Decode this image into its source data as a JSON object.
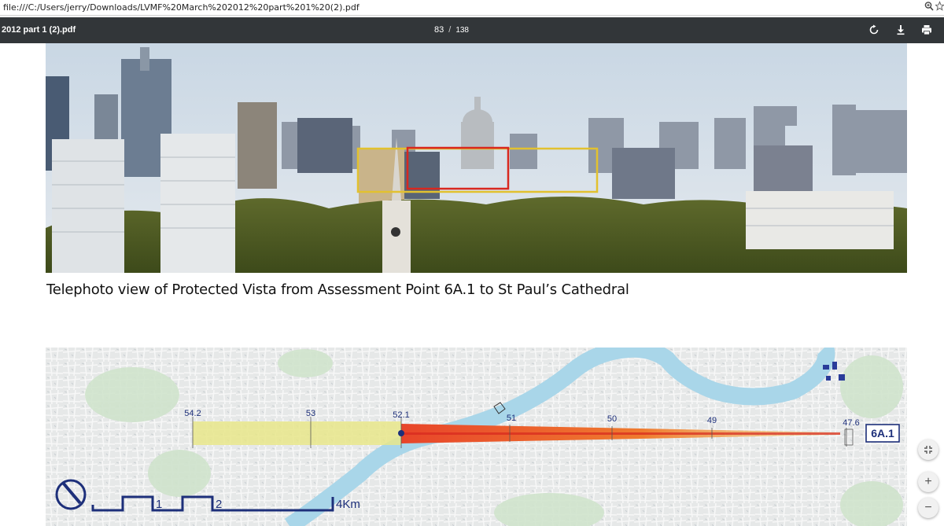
{
  "browser": {
    "url": "file:///C:/Users/jerry/Downloads/LVMF%20March%202012%20part%201%20(2).pdf",
    "icons": [
      "zoom-icon",
      "star-icon"
    ]
  },
  "viewer": {
    "title": "2012 part 1 (2).pdf",
    "current_page": "83",
    "separator": "/",
    "total_pages": "138",
    "icons": [
      "rotate-icon",
      "download-icon",
      "print-icon"
    ]
  },
  "document": {
    "caption": "Telephoto view of Protected Vista from Assessment Point 6A.1 to St Paul’s Cathedral",
    "map": {
      "markers": [
        "54.2",
        "53",
        "52.1",
        "51",
        "50",
        "49",
        "47.6"
      ],
      "assessment_point": "6A.1",
      "scale_labels": [
        "1",
        "2",
        "4Km"
      ]
    }
  },
  "controls": {
    "fit_icon": "fit-to-page-icon",
    "zoom_in_label": "+",
    "zoom_out_label": "−"
  },
  "colors": {
    "toolbar": "#323639",
    "vista_yellow": "#e8e68a",
    "vista_red": "#e8452a",
    "vista_orange": "#f2a23a",
    "map_label": "#1d2f7a"
  }
}
